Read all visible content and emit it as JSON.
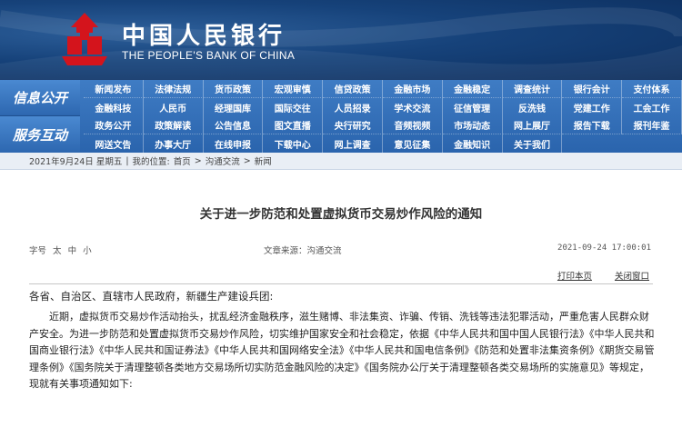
{
  "header": {
    "bank_name_cn": "中国人民银行",
    "bank_name_en": "THE PEOPLE'S BANK OF CHINA"
  },
  "nav": {
    "section1_label": "信息公开",
    "section2_label": "服务互动",
    "rows": [
      [
        "新闻发布",
        "法律法规",
        "货币政策",
        "宏观审慎",
        "信贷政策",
        "金融市场",
        "金融稳定",
        "调查统计",
        "银行会计",
        "支付体系"
      ],
      [
        "金融科技",
        "人民币",
        "经理国库",
        "国际交往",
        "人员招录",
        "学术交流",
        "征信管理",
        "反洗钱",
        "党建工作",
        "工会工作"
      ],
      [
        "政务公开",
        "政策解读",
        "公告信息",
        "图文直播",
        "央行研究",
        "音频视频",
        "市场动态",
        "网上展厅",
        "报告下载",
        "报刊年鉴"
      ],
      [
        "网送文告",
        "办事大厅",
        "在线申报",
        "下载中心",
        "网上调查",
        "意见征集",
        "金融知识",
        "关于我们",
        "",
        ""
      ]
    ]
  },
  "breadcrumb": {
    "date": "2021年9月24日 星期五",
    "location_label": "我的位置:",
    "items": [
      "首页",
      "沟通交流",
      "新闻"
    ],
    "separator": ">"
  },
  "article": {
    "title": "关于进一步防范和处置虚拟货币交易炒作风险的通知",
    "font_size_label": "字号",
    "font_sizes": [
      "太",
      "中",
      "小"
    ],
    "source": "文章来源：沟通交流",
    "datetime": "2021-09-24 17:00:01",
    "print_label": "打印本页",
    "close_label": "关闭窗口",
    "salutation": "各省、自治区、直辖市人民政府，新疆生产建设兵团:",
    "paragraph": "近期，虚拟货币交易炒作活动抬头，扰乱经济金融秩序，滋生赌博、非法集资、诈骗、传销、洗钱等违法犯罪活动，严重危害人民群众财产安全。为进一步防范和处置虚拟货币交易炒作风险，切实维护国家安全和社会稳定，依据《中华人民共和国中国人民银行法》《中华人民共和国商业银行法》《中华人民共和国证券法》《中华人民共和国网络安全法》《中华人民共和国电信条例》《防范和处置非法集资条例》《期货交易管理条例》《国务院关于清理整顿各类地方交易场所切实防范金融风险的决定》《国务院办公厅关于清理整顿各类交易场所的实施意见》等规定，现就有关事项通知如下:"
  },
  "colors": {
    "header_bg": "#16427a",
    "nav_bg": "#2a64ad",
    "breadcrumb_bg": "#e9eef5",
    "emblem_red": "#d4141c"
  }
}
